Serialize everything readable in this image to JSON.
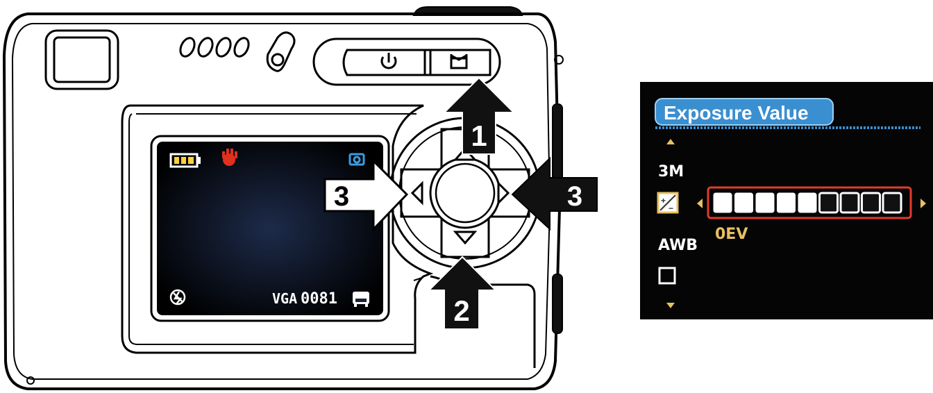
{
  "camera": {
    "lcd": {
      "resolution": "VGA",
      "frame_count": "0081",
      "icons": [
        "battery-icon",
        "hand-icon",
        "camera-mode-icon",
        "flash-off-icon",
        "memory-icon"
      ]
    },
    "top_buttons": {
      "power_icon": "power-icon",
      "mode_icon": "mode-icon"
    },
    "callouts": {
      "mode_button": "1",
      "down_button": "2",
      "left_button": "3",
      "right_button": "3"
    }
  },
  "exposure_menu": {
    "title": "Exposure Value",
    "items": [
      "3M",
      "AWB"
    ],
    "value_label": "0EV",
    "level": {
      "filled": 5,
      "total": 9
    },
    "colors": {
      "title_bg": "#3a8fd0",
      "highlight": "#e23a2a",
      "value_text": "#e8c060"
    }
  }
}
